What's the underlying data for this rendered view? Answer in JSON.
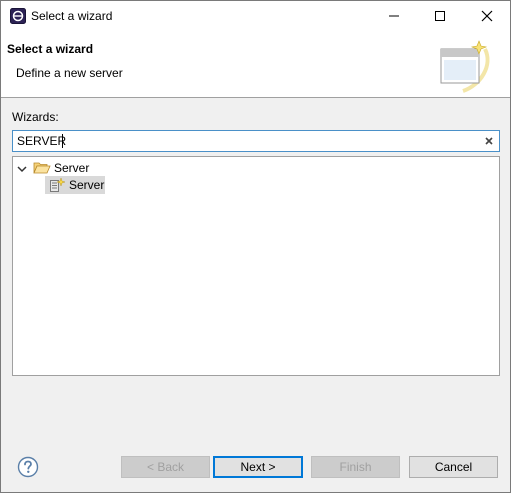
{
  "window": {
    "title": "Select a wizard"
  },
  "banner": {
    "title": "Select a wizard",
    "description": "Define a new server"
  },
  "wizards": {
    "label": "Wizards:",
    "filter_value": "SERVER"
  },
  "tree": {
    "category": {
      "label": "Server",
      "expanded": true
    },
    "items": [
      {
        "label": "Server",
        "selected": true
      }
    ]
  },
  "buttons": {
    "back": "< Back",
    "next": "Next >",
    "finish": "Finish",
    "cancel": "Cancel"
  },
  "icons": {
    "app": "eclipse-icon",
    "minimize": "minimize-icon",
    "maximize": "maximize-icon",
    "close": "close-icon",
    "banner": "wizard-banner-icon",
    "clear": "clear-icon",
    "expand": "chevron-down-icon",
    "folder": "folder-open-icon",
    "server": "server-wizard-icon",
    "help": "help-icon"
  },
  "colors": {
    "focus_border": "#4a90c8",
    "default_button_border": "#0078d7",
    "selection": "#d9d9d9"
  }
}
